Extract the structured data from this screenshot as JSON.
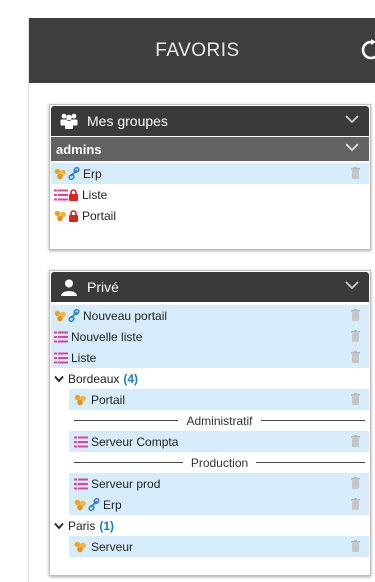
{
  "header": {
    "title": "FAVORIS",
    "refresh_icon": "refresh-icon"
  },
  "colors": {
    "header_bg": "#3e3e3e",
    "panel_head_bg": "#3a3a3a",
    "subhead_bg": "#626262",
    "highlight": "#d6ecfa",
    "count": "#1a7fc1"
  },
  "groups_panel": {
    "title": "Mes groupes",
    "subgroup": "admins",
    "items": [
      {
        "label": "Erp",
        "icons": [
          "portal-icon",
          "link-icon"
        ],
        "highlighted": true,
        "trash": true
      },
      {
        "label": "Liste",
        "icons": [
          "list-icon",
          "lock-icon"
        ],
        "highlighted": false,
        "trash": false
      },
      {
        "label": "Portail",
        "icons": [
          "portal-icon",
          "lock-icon"
        ],
        "highlighted": false,
        "trash": false
      }
    ]
  },
  "private_panel": {
    "title": "Privé",
    "items": [
      {
        "label": "Nouveau portail",
        "icons": [
          "portal-icon",
          "link-icon"
        ]
      },
      {
        "label": "Nouvelle liste",
        "icons": [
          "list-icon"
        ]
      },
      {
        "label": "Liste",
        "icons": [
          "list-icon"
        ]
      }
    ],
    "folders": [
      {
        "name": "Bordeaux",
        "count": "(4)",
        "items": [
          {
            "label": "Portail",
            "icons": [
              "portal-icon"
            ]
          }
        ],
        "sections": [
          {
            "title": "Administratif",
            "items": [
              {
                "label": "Serveur Compta",
                "icons": [
                  "list-icon"
                ]
              }
            ]
          },
          {
            "title": "Production",
            "items": [
              {
                "label": "Serveur prod",
                "icons": [
                  "list-icon"
                ]
              },
              {
                "label": "Erp",
                "icons": [
                  "portal-icon",
                  "link-icon"
                ]
              }
            ]
          }
        ]
      },
      {
        "name": "Paris",
        "count": "(1)",
        "items": [
          {
            "label": "Serveur",
            "icons": [
              "portal-icon"
            ]
          }
        ],
        "sections": []
      }
    ]
  }
}
